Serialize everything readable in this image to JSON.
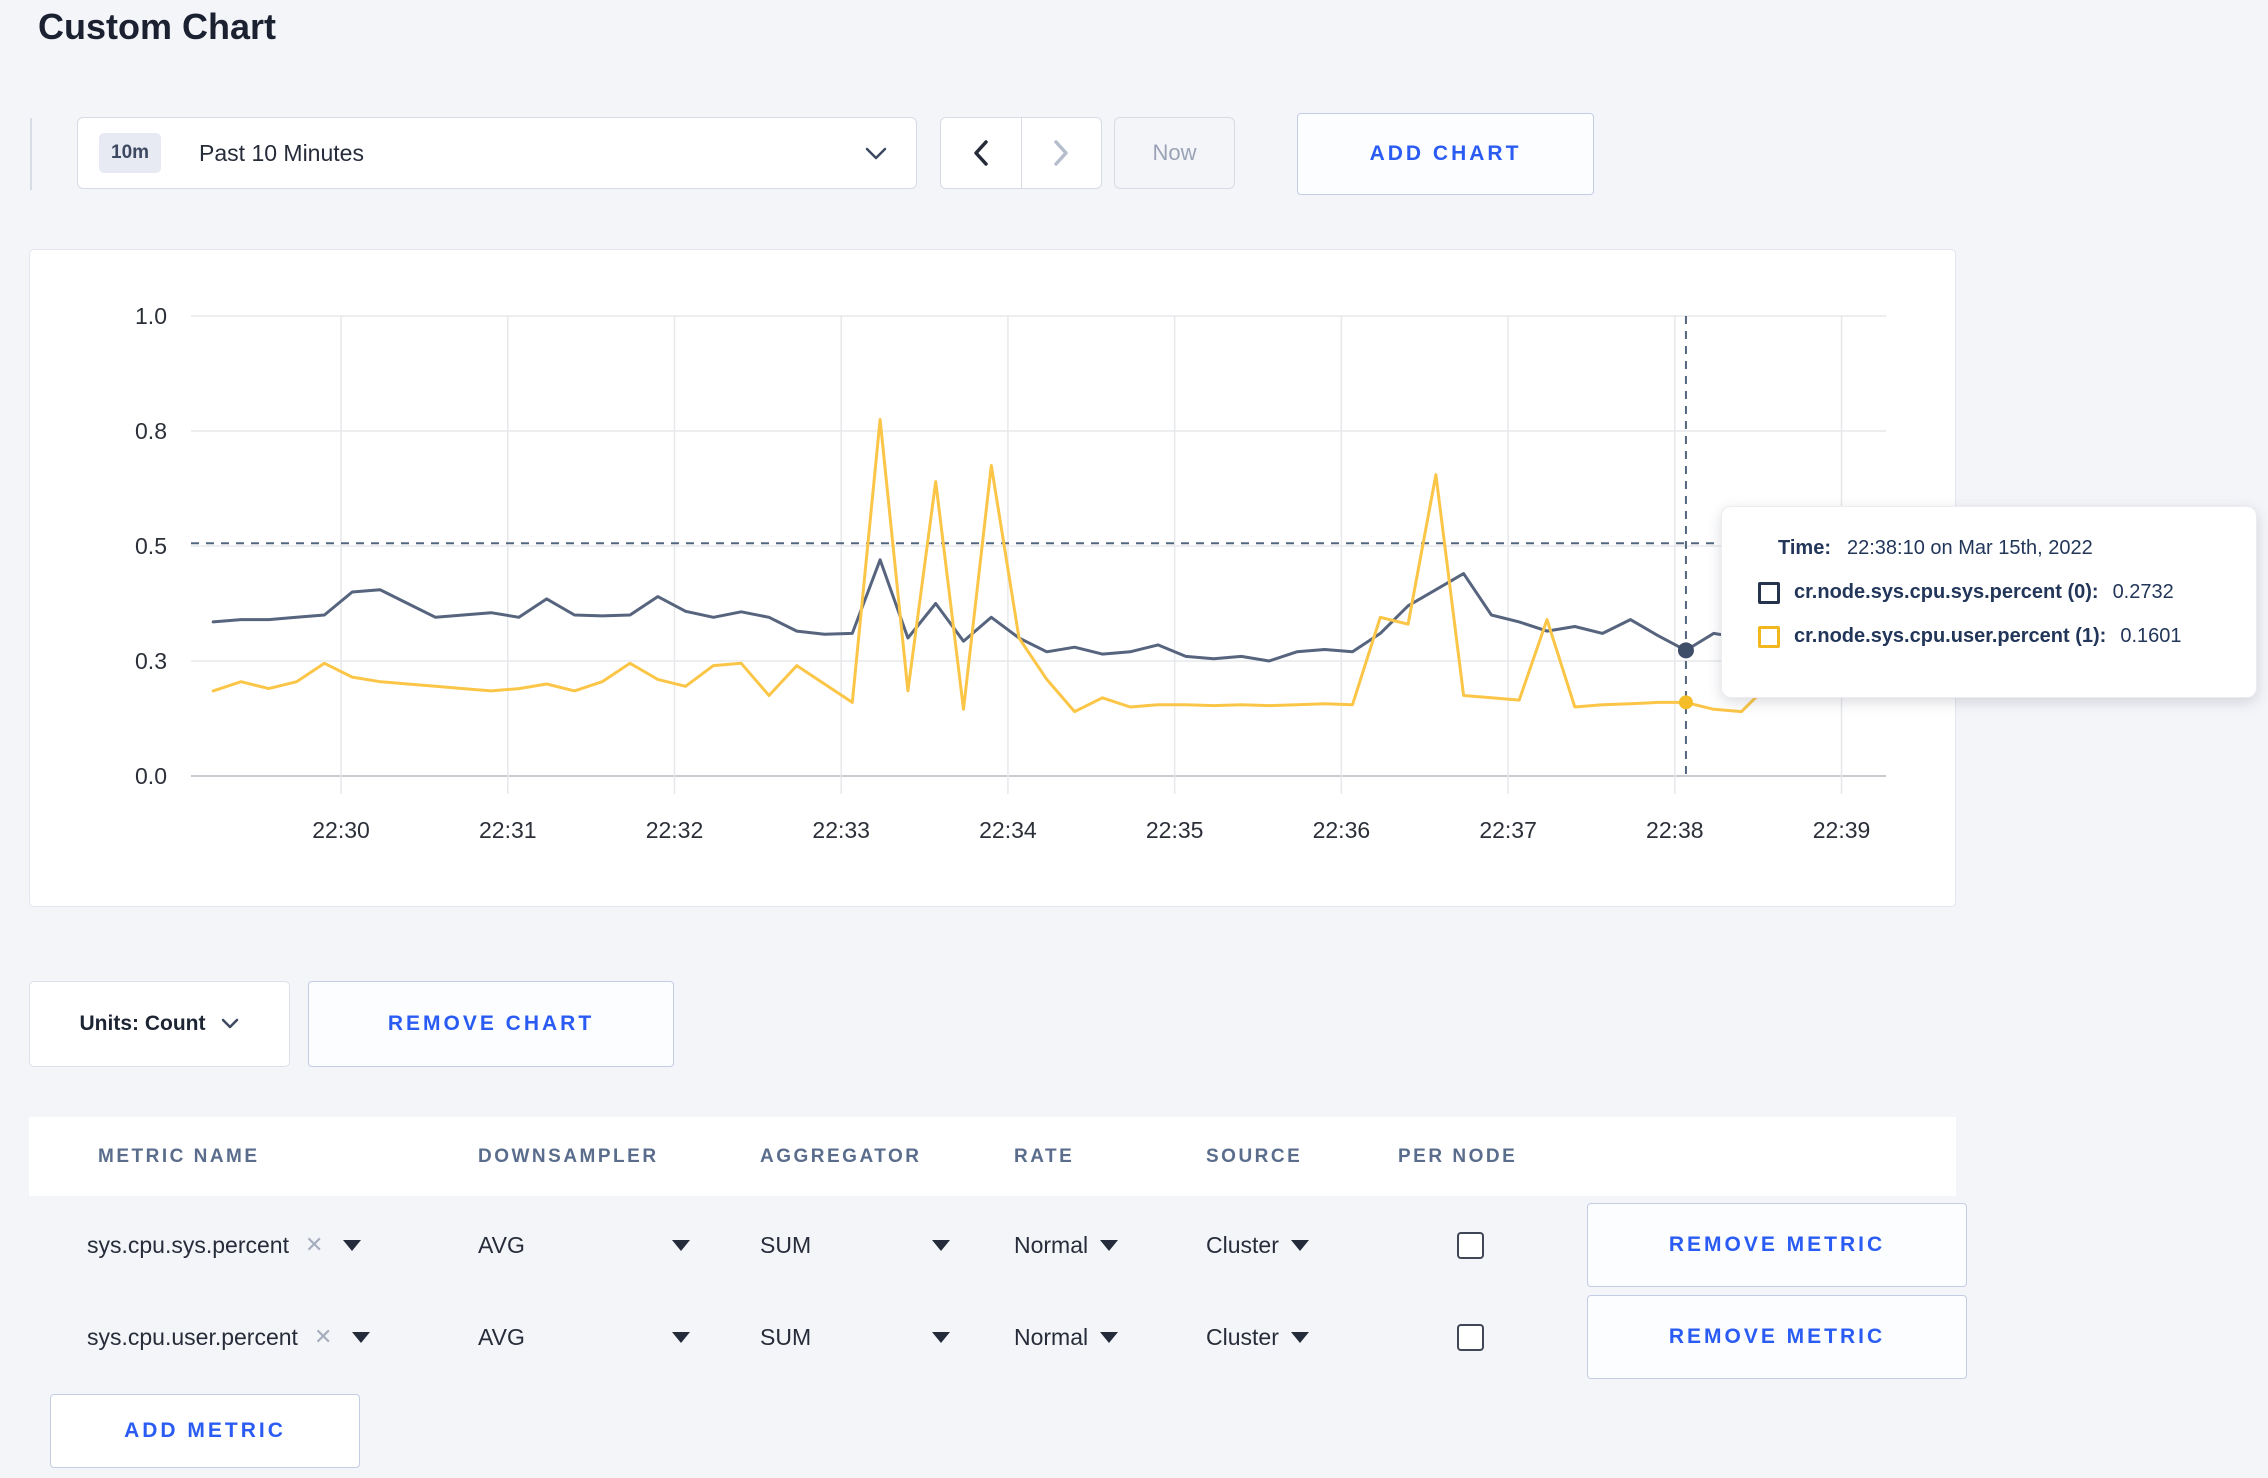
{
  "page": {
    "title": "Custom Chart"
  },
  "toolbar": {
    "time_badge": "10m",
    "time_label": "Past 10 Minutes",
    "now_label": "Now",
    "add_chart_label": "ADD CHART"
  },
  "colors": {
    "accent_blue": "#2a5cf4",
    "sys_line": "#56647e",
    "sys_dot": "#3e4d68",
    "user_line": "#fbc648",
    "user_dot": "#f5bd27",
    "sys_square": "#26334d",
    "user_square": "#f2b71c",
    "crosshair": "#52677f",
    "gridline": "#e7e8eb"
  },
  "chart_data": {
    "type": "line",
    "title": "",
    "xlabel": "",
    "ylabel": "",
    "ylim": [
      0,
      1
    ],
    "grid": true,
    "y_ticks": [
      {
        "v": 0.0,
        "label": "0.0"
      },
      {
        "v": 0.25,
        "label": "0.3"
      },
      {
        "v": 0.5,
        "label": "0.5"
      },
      {
        "v": 0.75,
        "label": "0.8"
      },
      {
        "v": 1.0,
        "label": "1.0"
      }
    ],
    "x_tick_labels": [
      "22:30",
      "22:31",
      "22:32",
      "22:33",
      "22:34",
      "22:35",
      "22:36",
      "22:37",
      "22:38",
      "22:39"
    ],
    "x_domain_seconds": 610,
    "x_first_tick_offset_seconds": 54,
    "x_tick_interval_seconds": 60,
    "series_start_offset_seconds": 8,
    "sample_interval_seconds": 10,
    "series": [
      {
        "name": "cr.node.sys.cpu.sys.percent",
        "values": [
          0.335,
          0.34,
          0.34,
          0.345,
          0.35,
          0.4,
          0.405,
          0.375,
          0.345,
          0.35,
          0.355,
          0.345,
          0.385,
          0.35,
          0.348,
          0.35,
          0.39,
          0.358,
          0.345,
          0.357,
          0.345,
          0.315,
          0.308,
          0.31,
          0.47,
          0.3,
          0.375,
          0.293,
          0.345,
          0.3,
          0.27,
          0.28,
          0.265,
          0.27,
          0.285,
          0.26,
          0.255,
          0.26,
          0.25,
          0.27,
          0.275,
          0.27,
          0.31,
          0.37,
          0.405,
          0.44,
          0.35,
          0.335,
          0.315,
          0.325,
          0.31,
          0.34,
          0.305,
          0.273,
          0.31,
          0.3,
          0.31,
          0.305,
          0.31,
          0.3,
          0.315
        ]
      },
      {
        "name": "cr.node.sys.cpu.user.percent",
        "values": [
          0.185,
          0.205,
          0.19,
          0.205,
          0.245,
          0.215,
          0.205,
          0.2,
          0.195,
          0.19,
          0.185,
          0.19,
          0.2,
          0.185,
          0.205,
          0.245,
          0.21,
          0.195,
          0.24,
          0.245,
          0.175,
          0.24,
          0.2,
          0.16,
          0.775,
          0.185,
          0.64,
          0.145,
          0.675,
          0.3,
          0.21,
          0.14,
          0.17,
          0.15,
          0.155,
          0.155,
          0.153,
          0.155,
          0.153,
          0.155,
          0.157,
          0.155,
          0.345,
          0.33,
          0.655,
          0.175,
          0.17,
          0.165,
          0.34,
          0.15,
          0.155,
          0.157,
          0.16,
          0.16,
          0.145,
          0.14,
          0.2,
          0.27,
          0.27,
          0.215,
          0.27
        ]
      }
    ],
    "hover": {
      "sample_index": 53,
      "h_line_value": 0.506,
      "sys_value": 0.2732,
      "user_value": 0.1601
    }
  },
  "tooltip": {
    "time_label": "Time:",
    "time_value": "22:38:10 on Mar 15th, 2022",
    "rows": [
      {
        "label": "cr.node.sys.cpu.sys.percent (0):",
        "value": "0.2732"
      },
      {
        "label": "cr.node.sys.cpu.user.percent (1):",
        "value": "0.1601"
      }
    ]
  },
  "units": {
    "label": "Units: Count",
    "remove_chart_label": "REMOVE CHART"
  },
  "table": {
    "headers": [
      "METRIC NAME",
      "DOWNSAMPLER",
      "AGGREGATOR",
      "RATE",
      "SOURCE",
      "PER NODE"
    ],
    "remove_metric_label": "REMOVE METRIC",
    "add_metric_label": "ADD METRIC",
    "rows": [
      {
        "metric": "sys.cpu.sys.percent",
        "downsampler": "AVG",
        "aggregator": "SUM",
        "rate": "Normal",
        "source": "Cluster",
        "per_node": false
      },
      {
        "metric": "sys.cpu.user.percent",
        "downsampler": "AVG",
        "aggregator": "SUM",
        "rate": "Normal",
        "source": "Cluster",
        "per_node": false
      }
    ]
  }
}
